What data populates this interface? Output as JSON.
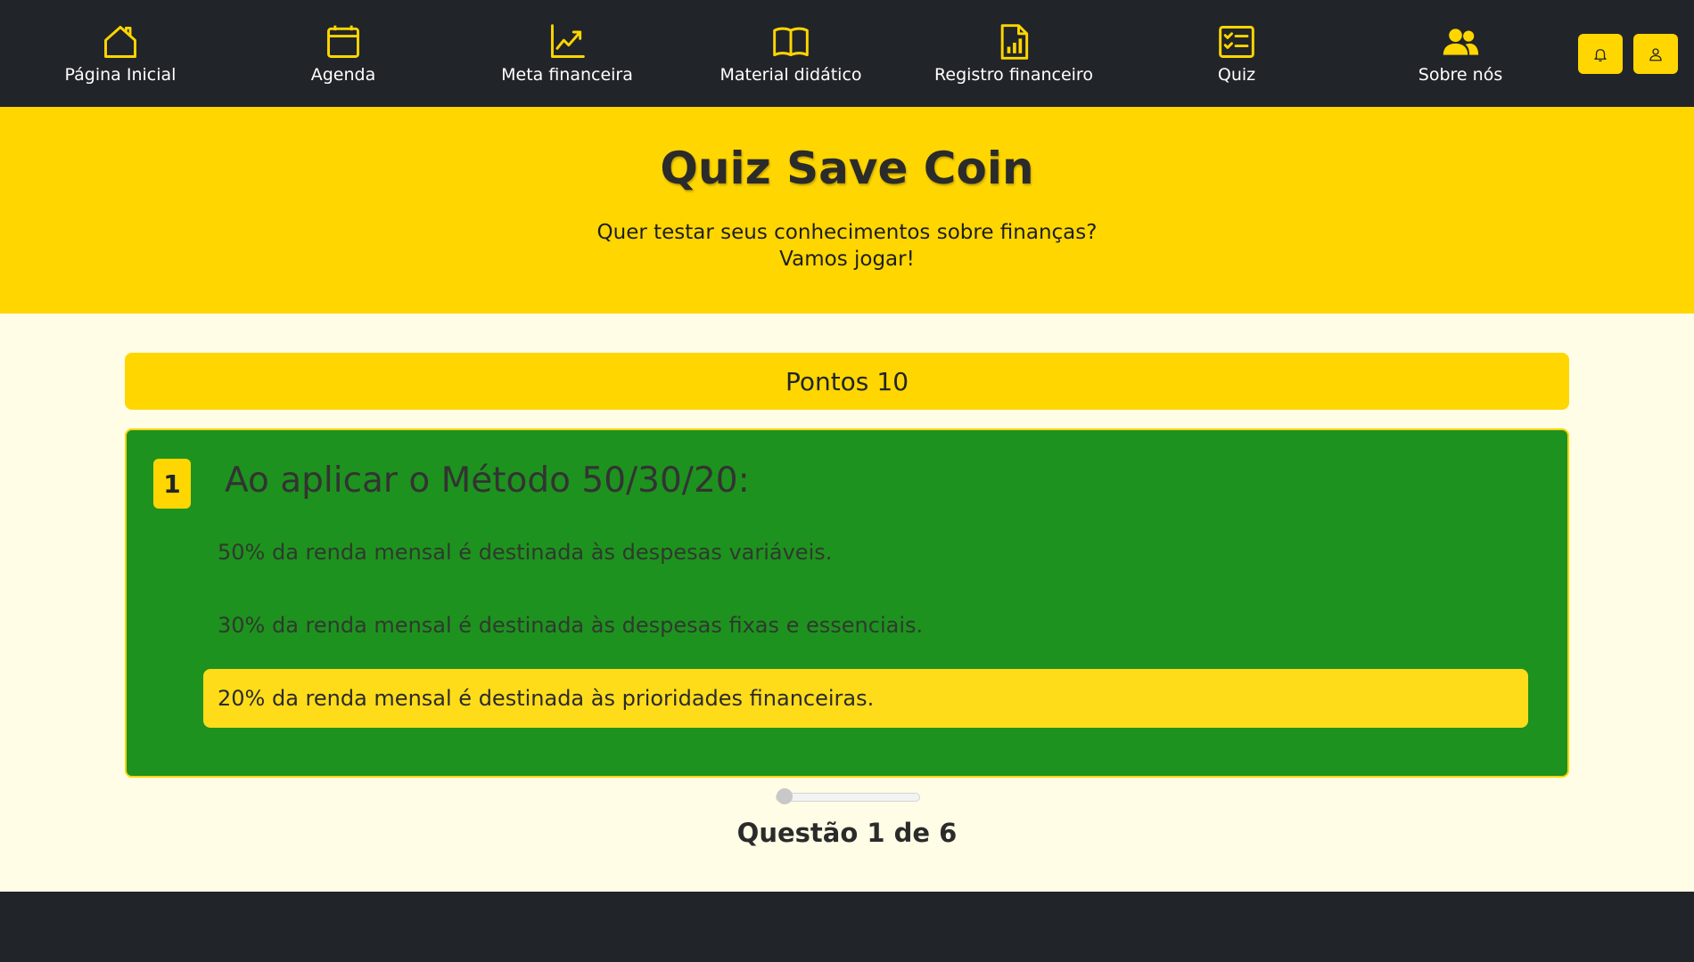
{
  "nav": {
    "items": [
      {
        "label": "Página Inicial",
        "icon": "home-icon"
      },
      {
        "label": "Agenda",
        "icon": "calendar-icon"
      },
      {
        "label": "Meta financeira",
        "icon": "chart-up-icon"
      },
      {
        "label": "Material didático",
        "icon": "book-icon"
      },
      {
        "label": "Registro financeiro",
        "icon": "report-icon"
      },
      {
        "label": "Quiz",
        "icon": "checklist-icon"
      },
      {
        "label": "Sobre nós",
        "icon": "people-icon"
      }
    ],
    "buttons": [
      {
        "icon": "bell-icon"
      },
      {
        "icon": "user-icon"
      }
    ]
  },
  "hero": {
    "title": "Quiz Save Coin",
    "subtitle_line1": "Quer testar seus conhecimentos sobre finanças?",
    "subtitle_line2": "Vamos jogar!"
  },
  "score": {
    "label": "Pontos",
    "value": "10"
  },
  "question": {
    "number": "1",
    "text": "Ao aplicar o Método 50/30/20:",
    "answers": [
      {
        "text": "50% da renda mensal é destinada às despesas variáveis.",
        "selected": false
      },
      {
        "text": "30% da renda mensal é destinada às despesas fixas e essenciais.",
        "selected": false
      },
      {
        "text": "20% da renda mensal é destinada às prioridades financeiras.",
        "selected": true
      }
    ]
  },
  "progress": {
    "current": 1,
    "total": 6,
    "fraction": 0,
    "label": "Questão 1 de 6"
  },
  "colors": {
    "navbar": "#212529",
    "accent": "#ffd600",
    "card": "#1e921e",
    "background": "#fffde6"
  }
}
